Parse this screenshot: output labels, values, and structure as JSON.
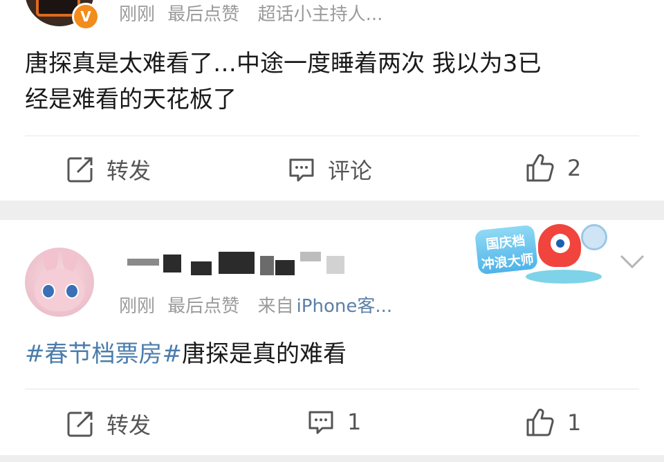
{
  "post1": {
    "meta": {
      "time": "刚刚",
      "activity": "最后点赞",
      "source": "超话小主持人..."
    },
    "badge": "V",
    "content": [
      "唐探真是太难看了…中途一度睡着两次 我以为3已",
      "经是难看的天花板了"
    ],
    "actions": {
      "repost": "转发",
      "comment": "评论",
      "like_count": "2"
    }
  },
  "post2": {
    "meta": {
      "time": "刚刚",
      "activity": "最后点赞",
      "source_prefix": "来自",
      "source": "iPhone客..."
    },
    "content": {
      "hashtag": "#春节档票房#",
      "text": "唐探是真的难看"
    },
    "sticker_text": [
      "国庆档",
      "冲浪大师"
    ],
    "actions": {
      "repost": "转发",
      "comment_count": "1",
      "like_count": "1"
    }
  },
  "colors": {
    "hashtag": "#4a7cac",
    "meta": "#9a9a9a",
    "background": "#eeeeee"
  }
}
